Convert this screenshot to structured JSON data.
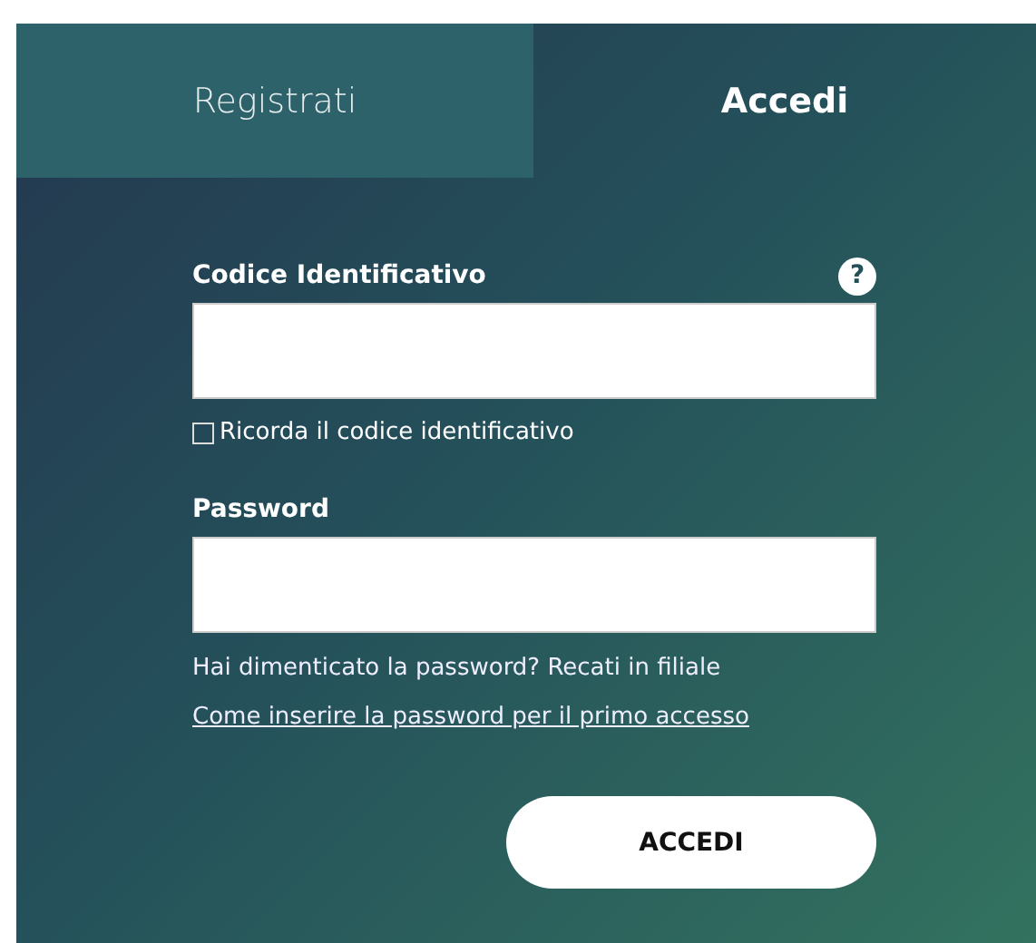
{
  "tabs": [
    {
      "label": "Registrati",
      "selected": false
    },
    {
      "label": "Accedi",
      "selected": true
    }
  ],
  "form": {
    "code_label": "Codice Identificativo",
    "help_icon": "?",
    "remember": {
      "label": "Ricorda il codice identificativo",
      "checked": false
    },
    "password_label": "Password",
    "forgot_text": "Hai dimenticato la password? Recati in filiale",
    "first_access_link": "Come inserire la password per il primo accesso",
    "submit": "ACCEDI"
  }
}
